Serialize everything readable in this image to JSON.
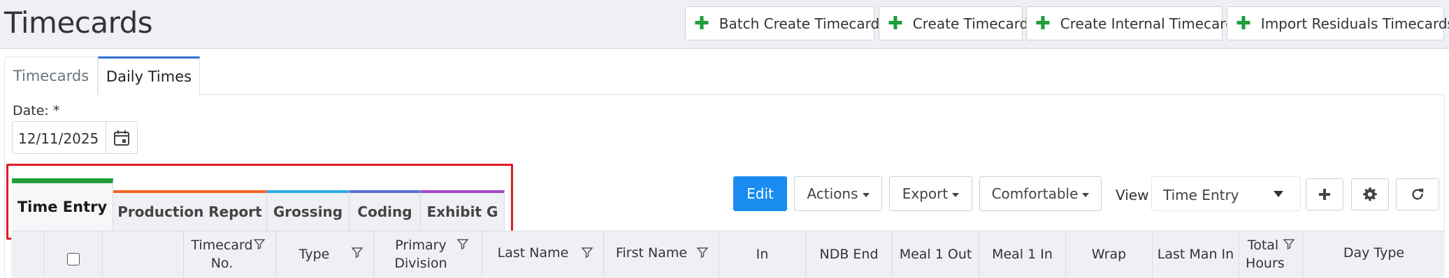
{
  "header": {
    "title": "Timecards",
    "buttons": [
      {
        "label": "Batch Create Timecards"
      },
      {
        "label": "Create Timecard"
      },
      {
        "label": "Create Internal Timecard"
      },
      {
        "label": "Import Residuals Timecards"
      }
    ]
  },
  "tabs": [
    {
      "label": "Timecards",
      "active": false
    },
    {
      "label": "Daily Times",
      "active": true
    }
  ],
  "date": {
    "label": "Date: *",
    "value": "12/11/2025"
  },
  "section_tabs": [
    {
      "label": "Time Entry",
      "color": "#1f9d3a",
      "active": true
    },
    {
      "label": "Production Report",
      "color": "#f26522",
      "active": false
    },
    {
      "label": "Grossing",
      "color": "#29abe2",
      "active": false
    },
    {
      "label": "Coding",
      "color": "#5b6fd6",
      "active": false
    },
    {
      "label": "Exhibit G",
      "color": "#a349c6",
      "active": false
    }
  ],
  "toolbar": {
    "edit": "Edit",
    "actions": "Actions",
    "export": "Export",
    "density": "Comfortable",
    "view_label": "View",
    "view_value": "Time Entry"
  },
  "columns": [
    {
      "label": "Timecard No."
    },
    {
      "label": "Type"
    },
    {
      "label": "Primary Division"
    },
    {
      "label": "Last Name"
    },
    {
      "label": "First Name"
    },
    {
      "label": "In"
    },
    {
      "label": "NDB End"
    },
    {
      "label": "Meal 1 Out"
    },
    {
      "label": "Meal 1 In"
    },
    {
      "label": "Wrap"
    },
    {
      "label": "Last Man In"
    },
    {
      "label": "Total Hours"
    },
    {
      "label": "Day Type"
    }
  ],
  "colors": {
    "primary": "#1a8cf0",
    "add_icon": "#1f9d3a",
    "highlight": "#e01b24",
    "active_tab": "#2f6fd1"
  }
}
